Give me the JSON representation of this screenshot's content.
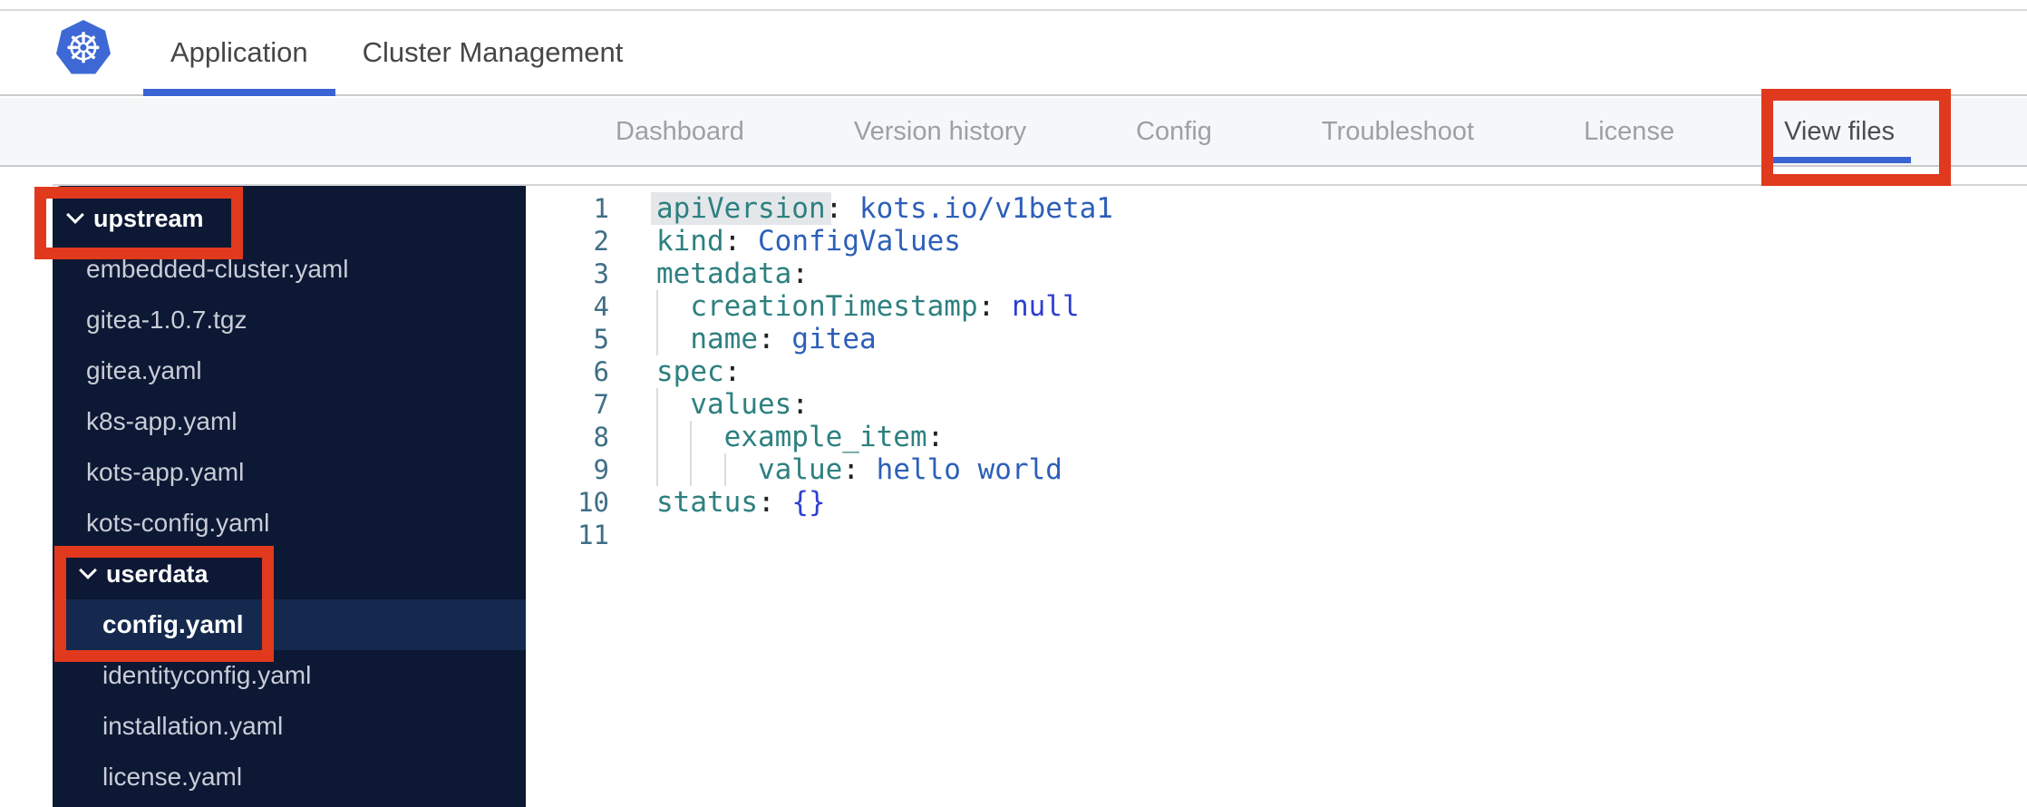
{
  "header": {
    "logo": "kubernetes-logo",
    "tabs": [
      {
        "label": "Application",
        "active": true
      },
      {
        "label": "Cluster Management",
        "active": false
      }
    ]
  },
  "subnav": {
    "tabs": [
      {
        "label": "Dashboard",
        "active": false
      },
      {
        "label": "Version history",
        "active": false
      },
      {
        "label": "Config",
        "active": false
      },
      {
        "label": "Troubleshoot",
        "active": false
      },
      {
        "label": "License",
        "active": false
      },
      {
        "label": "View files",
        "active": true
      }
    ]
  },
  "file_tree": {
    "items": [
      {
        "type": "folder",
        "label": "upstream",
        "level": 1,
        "expanded": true,
        "selected": false
      },
      {
        "type": "file",
        "label": "embedded-cluster.yaml",
        "level": 1,
        "selected": false
      },
      {
        "type": "file",
        "label": "gitea-1.0.7.tgz",
        "level": 1,
        "selected": false
      },
      {
        "type": "file",
        "label": "gitea.yaml",
        "level": 1,
        "selected": false
      },
      {
        "type": "file",
        "label": "k8s-app.yaml",
        "level": 1,
        "selected": false
      },
      {
        "type": "file",
        "label": "kots-app.yaml",
        "level": 1,
        "selected": false
      },
      {
        "type": "file",
        "label": "kots-config.yaml",
        "level": 1,
        "selected": false
      },
      {
        "type": "folder",
        "label": "userdata",
        "level": 2,
        "expanded": true,
        "selected": false
      },
      {
        "type": "file",
        "label": "config.yaml",
        "level": 2,
        "selected": true
      },
      {
        "type": "file",
        "label": "identityconfig.yaml",
        "level": 2,
        "selected": false
      },
      {
        "type": "file",
        "label": "installation.yaml",
        "level": 2,
        "selected": false
      },
      {
        "type": "file",
        "label": "license.yaml",
        "level": 2,
        "selected": false
      }
    ]
  },
  "editor": {
    "language": "yaml",
    "lines": [
      {
        "number": "1",
        "tokens": [
          {
            "t": "apiVersion",
            "c": "key",
            "hl": true
          },
          {
            "t": ":",
            "c": "punc"
          },
          {
            "t": " ",
            "c": "plain"
          },
          {
            "t": "kots.io/v1beta1",
            "c": "value"
          }
        ]
      },
      {
        "number": "2",
        "tokens": [
          {
            "t": "kind",
            "c": "key"
          },
          {
            "t": ":",
            "c": "punc"
          },
          {
            "t": " ",
            "c": "plain"
          },
          {
            "t": "ConfigValues",
            "c": "value"
          }
        ]
      },
      {
        "number": "3",
        "tokens": [
          {
            "t": "metadata",
            "c": "key"
          },
          {
            "t": ":",
            "c": "punc"
          }
        ]
      },
      {
        "number": "4",
        "tokens": [
          {
            "t": "  ",
            "c": "ind"
          },
          {
            "t": "creationTimestamp",
            "c": "key"
          },
          {
            "t": ":",
            "c": "punc"
          },
          {
            "t": " ",
            "c": "plain"
          },
          {
            "t": "null",
            "c": "literal"
          }
        ]
      },
      {
        "number": "5",
        "tokens": [
          {
            "t": "  ",
            "c": "ind"
          },
          {
            "t": "name",
            "c": "key"
          },
          {
            "t": ":",
            "c": "punc"
          },
          {
            "t": " ",
            "c": "plain"
          },
          {
            "t": "gitea",
            "c": "value"
          }
        ]
      },
      {
        "number": "6",
        "tokens": [
          {
            "t": "spec",
            "c": "key"
          },
          {
            "t": ":",
            "c": "punc"
          }
        ]
      },
      {
        "number": "7",
        "tokens": [
          {
            "t": "  ",
            "c": "ind"
          },
          {
            "t": "values",
            "c": "key"
          },
          {
            "t": ":",
            "c": "punc"
          }
        ]
      },
      {
        "number": "8",
        "tokens": [
          {
            "t": "  ",
            "c": "ind"
          },
          {
            "t": "  ",
            "c": "ind"
          },
          {
            "t": "example_item",
            "c": "key"
          },
          {
            "t": ":",
            "c": "punc"
          }
        ]
      },
      {
        "number": "9",
        "tokens": [
          {
            "t": "  ",
            "c": "ind"
          },
          {
            "t": "  ",
            "c": "ind"
          },
          {
            "t": "  ",
            "c": "ind"
          },
          {
            "t": "value",
            "c": "key"
          },
          {
            "t": ":",
            "c": "punc"
          },
          {
            "t": " ",
            "c": "plain"
          },
          {
            "t": "hello world",
            "c": "value"
          }
        ]
      },
      {
        "number": "10",
        "tokens": [
          {
            "t": "status",
            "c": "key"
          },
          {
            "t": ":",
            "c": "punc"
          },
          {
            "t": " ",
            "c": "plain"
          },
          {
            "t": "{}",
            "c": "literal"
          }
        ]
      },
      {
        "number": "11",
        "tokens": []
      }
    ]
  },
  "annotations": [
    {
      "target": "view-files-tab"
    },
    {
      "target": "upstream-folder"
    },
    {
      "target": "userdata-folder-and-config-yaml"
    }
  ],
  "colors": {
    "brand_blue": "#3e68d6",
    "active_underline": "#3a63d4",
    "annotation_red": "#e0391d",
    "sidebar_bg": "#0c1834",
    "sidebar_selected_bg": "#14294d",
    "code_key": "#2e8080",
    "code_value": "#2d5fb8",
    "code_literal": "#2f3fd0",
    "gutter": "#3f6e85"
  }
}
